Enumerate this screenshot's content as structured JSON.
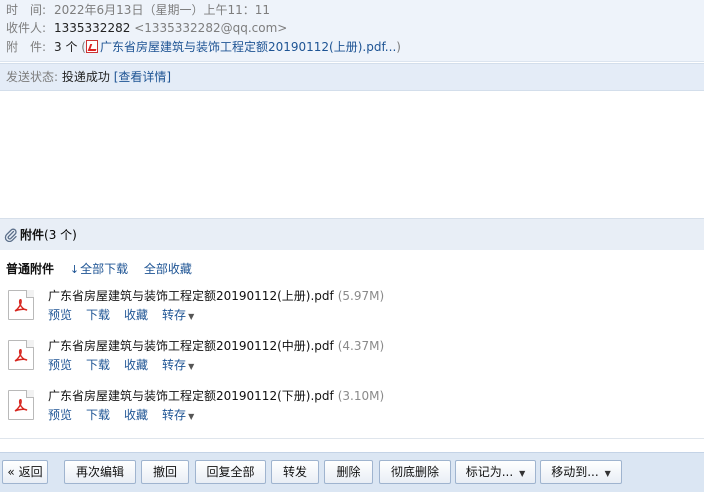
{
  "header": {
    "time_label": "时　间:",
    "time_value": "2022年6月13日（星期一）上午11：11",
    "to_label": "收件人:",
    "to_name": "1335332282",
    "to_email": "<1335332282@qq.com>",
    "attach_label": "附　件:",
    "attach_count": "3 个",
    "attach_preview": "广东省房屋建筑与装饰工程定额20190112(上册).pdf..."
  },
  "status": {
    "label": "发送状态:",
    "value": "投递成功",
    "detail_link": "[查看详情]"
  },
  "attachments": {
    "title": "附件",
    "count": "(3 个)",
    "section_label": "普通附件",
    "download_all": "全部下载",
    "collect_all": "全部收藏",
    "actions": {
      "preview": "预览",
      "download": "下载",
      "collect": "收藏",
      "saveto": "转存"
    },
    "files": [
      {
        "name": "广东省房屋建筑与装饰工程定额20190112(上册).pdf",
        "size": "(5.97M)"
      },
      {
        "name": "广东省房屋建筑与装饰工程定额20190112(中册).pdf",
        "size": "(4.37M)"
      },
      {
        "name": "广东省房屋建筑与装饰工程定额20190112(下册).pdf",
        "size": "(3.10M)"
      }
    ]
  },
  "toolbar": {
    "back": "« 返回",
    "reedit": "再次编辑",
    "recall": "撤回",
    "reply_all": "回复全部",
    "forward": "转发",
    "delete": "删除",
    "delete_perm": "彻底删除",
    "mark_as": "标记为...",
    "move_to": "移动到..."
  },
  "icons": {
    "pdf": "pdf-file-icon",
    "clip": "paperclip-icon",
    "download_arrow": "download-arrow-icon",
    "dropdown": "chevron-down-icon"
  }
}
